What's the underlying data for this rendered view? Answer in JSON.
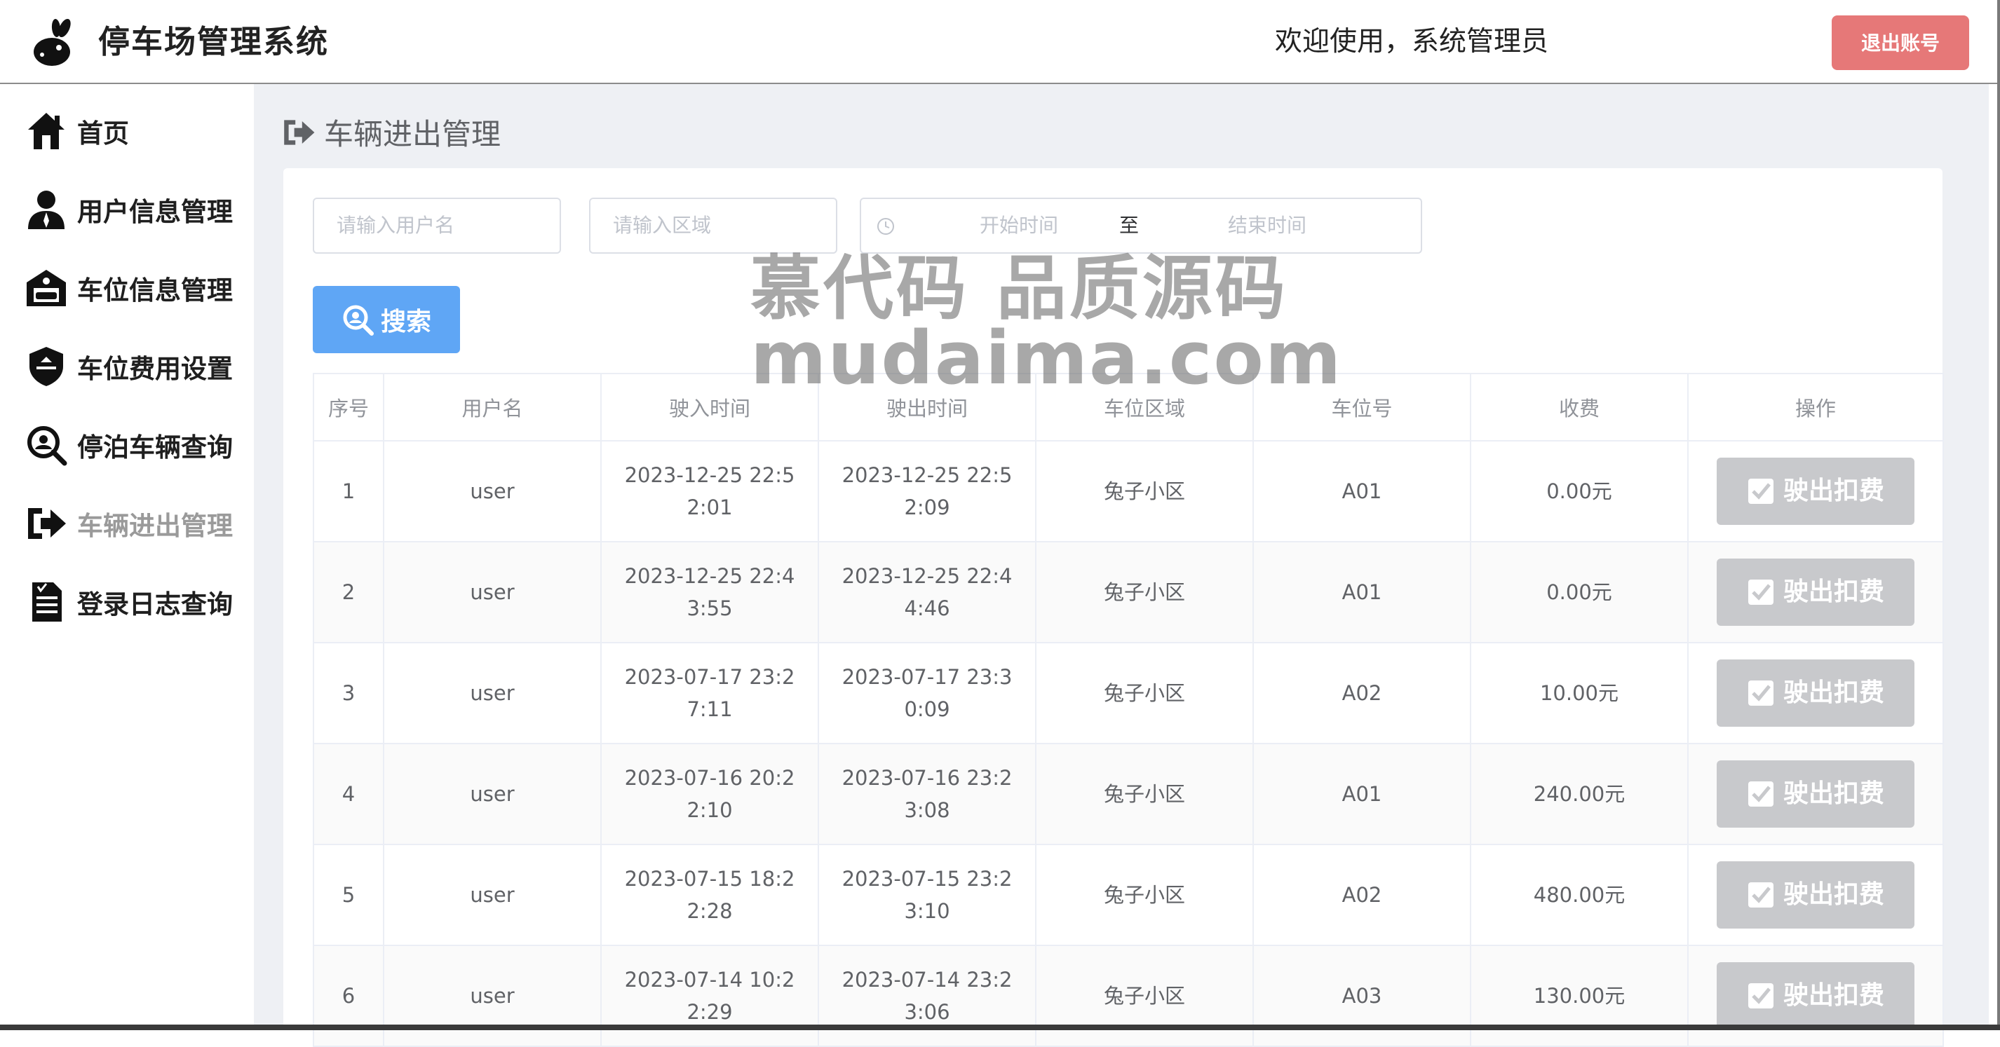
{
  "header": {
    "app_title": "停车场管理系统",
    "welcome": "欢迎使用，系统管理员",
    "logout_label": "退出账号"
  },
  "sidebar": {
    "items": [
      {
        "label": "首页",
        "icon": "home-icon"
      },
      {
        "label": "用户信息管理",
        "icon": "user-icon"
      },
      {
        "label": "车位信息管理",
        "icon": "garage-icon"
      },
      {
        "label": "车位费用设置",
        "icon": "shield-icon"
      },
      {
        "label": "停泊车辆查询",
        "icon": "magnifier-icon"
      },
      {
        "label": "车辆进出管理",
        "icon": "arrow-right-icon",
        "active": true
      },
      {
        "label": "登录日志查询",
        "icon": "document-icon"
      }
    ]
  },
  "main": {
    "page_title": "车辆进出管理",
    "filters": {
      "username_placeholder": "请输入用户名",
      "area_placeholder": "请输入区域",
      "start_placeholder": "开始时间",
      "range_separator": "至",
      "end_placeholder": "结束时间"
    },
    "search_label": "搜索",
    "table": {
      "columns": [
        "序号",
        "用户名",
        "驶入时间",
        "驶出时间",
        "车位区域",
        "车位号",
        "收费",
        "操作"
      ],
      "rows": [
        {
          "no": "1",
          "user": "user",
          "in": "2023-12-25 22:52:01",
          "out": "2023-12-25 22:52:09",
          "area": "兔子小区",
          "slot": "A01",
          "fee": "0.00元",
          "action": "驶出扣费"
        },
        {
          "no": "2",
          "user": "user",
          "in": "2023-12-25 22:43:55",
          "out": "2023-12-25 22:44:46",
          "area": "兔子小区",
          "slot": "A01",
          "fee": "0.00元",
          "action": "驶出扣费"
        },
        {
          "no": "3",
          "user": "user",
          "in": "2023-07-17 23:27:11",
          "out": "2023-07-17 23:30:09",
          "area": "兔子小区",
          "slot": "A02",
          "fee": "10.00元",
          "action": "驶出扣费"
        },
        {
          "no": "4",
          "user": "user",
          "in": "2023-07-16 20:22:10",
          "out": "2023-07-16 23:23:08",
          "area": "兔子小区",
          "slot": "A01",
          "fee": "240.00元",
          "action": "驶出扣费"
        },
        {
          "no": "5",
          "user": "user",
          "in": "2023-07-15 18:22:28",
          "out": "2023-07-15 23:23:10",
          "area": "兔子小区",
          "slot": "A02",
          "fee": "480.00元",
          "action": "驶出扣费"
        },
        {
          "no": "6",
          "user": "user",
          "in": "2023-07-14 10:22:29",
          "out": "2023-07-14 23:23:06",
          "area": "兔子小区",
          "slot": "A03",
          "fee": "130.00元",
          "action": "驶出扣费"
        }
      ]
    }
  },
  "watermark": {
    "line1": "慕代码 品质源码",
    "line2": "mudaima.com"
  },
  "colors": {
    "logout_bg": "#e67878",
    "search_bg": "#5fa6f5",
    "op_button_bg": "#c8c9cc",
    "main_bg": "#eef0f4"
  }
}
